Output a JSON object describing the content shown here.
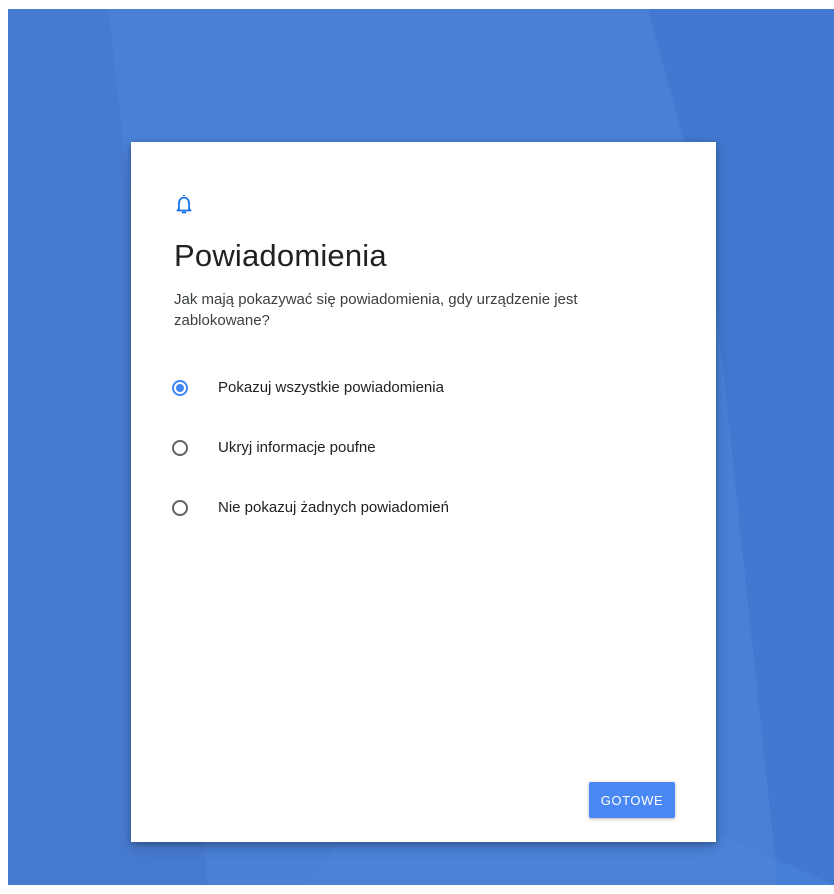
{
  "screen": {
    "background_color": "#4a80d6",
    "accent_color": "#4285f4"
  },
  "dialog": {
    "icon": "bell-icon",
    "title": "Powiadomienia",
    "subtitle": "Jak mają pokazywać się powiadomienia, gdy urządzenie jest zablokowane?",
    "options": [
      {
        "label": "Pokazuj wszystkie powiadomienia",
        "selected": true
      },
      {
        "label": "Ukryj informacje poufne",
        "selected": false
      },
      {
        "label": "Nie pokazuj żadnych powiadomień",
        "selected": false
      }
    ],
    "done_button_label": "GOTOWE"
  }
}
